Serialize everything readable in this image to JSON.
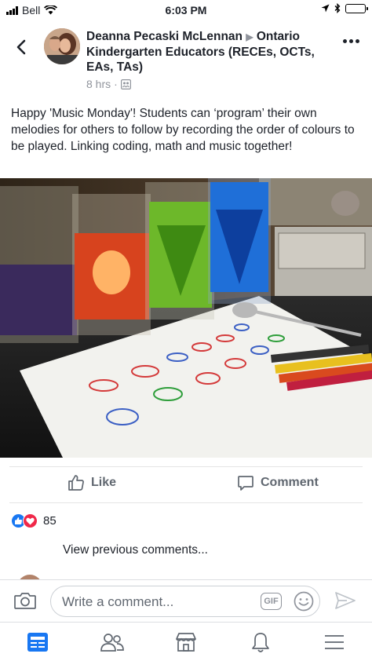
{
  "status_bar": {
    "carrier": "Bell",
    "time": "6:03 PM"
  },
  "post": {
    "author": "Deanna Pecaski McLennan",
    "group": "Ontario Kindergarten Educators (RECEs, OCTs, EAs, TAs)",
    "time_ago": "8 hrs",
    "body": "Happy 'Music Monday'! Students can ‘program’ their own melodies for others to follow by recording the order of colours to be played. Linking coding, math and music together!"
  },
  "actions": {
    "like_label": "Like",
    "comment_label": "Comment"
  },
  "reactions": {
    "count": "85",
    "types": [
      "like",
      "love"
    ]
  },
  "comments": {
    "view_previous": "View previous comments..."
  },
  "composer": {
    "placeholder": "Write a comment...",
    "gif_label": "GIF"
  },
  "tabbar": {
    "items": [
      "news-feed",
      "friends",
      "marketplace",
      "notifications",
      "menu"
    ],
    "active": "news-feed"
  },
  "colors": {
    "accent": "#1877f2",
    "love": "#f02849",
    "text": "#1d2129",
    "muted": "#90949c"
  },
  "icons": [
    "wifi-icon",
    "location-arrow-icon",
    "bluetooth-icon",
    "battery-icon",
    "back-chevron-icon",
    "more-dots-icon",
    "audience-group-icon",
    "like-thumb-icon",
    "comment-bubble-icon",
    "camera-icon",
    "emoji-icon",
    "send-icon"
  ]
}
